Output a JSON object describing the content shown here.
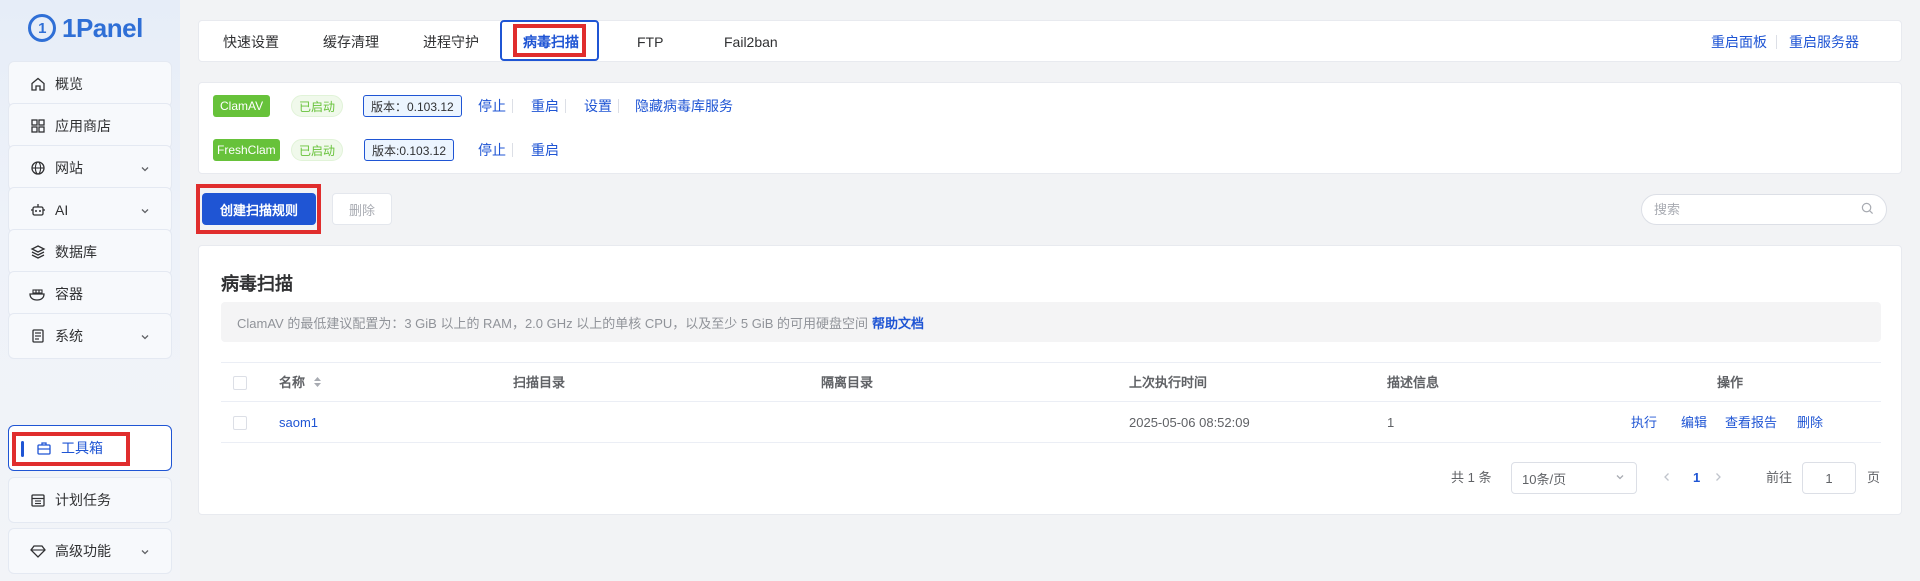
{
  "app": {
    "logo_text": "1Panel",
    "logo_mark": "1"
  },
  "sidebar": {
    "items": [
      {
        "label": "概览",
        "icon": "home-icon",
        "has_children": false
      },
      {
        "label": "应用商店",
        "icon": "grid-icon",
        "has_children": false
      },
      {
        "label": "网站",
        "icon": "globe-icon",
        "has_children": true
      },
      {
        "label": "AI",
        "icon": "robot-icon",
        "has_children": true
      },
      {
        "label": "数据库",
        "icon": "layers-icon",
        "has_children": false
      },
      {
        "label": "容器",
        "icon": "container-icon",
        "has_children": false
      },
      {
        "label": "系统",
        "icon": "system-icon",
        "has_children": true
      },
      {
        "label": "工具箱",
        "icon": "toolbox-icon",
        "has_children": false,
        "active": true
      },
      {
        "label": "计划任务",
        "icon": "calendar-icon",
        "has_children": false
      },
      {
        "label": "高级功能",
        "icon": "diamond-icon",
        "has_children": true
      }
    ]
  },
  "tabs": [
    {
      "label": "快速设置"
    },
    {
      "label": "缓存清理"
    },
    {
      "label": "进程守护"
    },
    {
      "label": "病毒扫描",
      "active": true
    },
    {
      "label": "FTP"
    },
    {
      "label": "Fail2ban"
    }
  ],
  "header_actions": {
    "restart_panel": "重启面板",
    "restart_server": "重启服务器"
  },
  "services": [
    {
      "name": "ClamAV",
      "status": "已启动",
      "version": "版本：0.103.12",
      "actions": [
        "停止",
        "重启",
        "设置",
        "隐藏病毒库服务"
      ]
    },
    {
      "name": "FreshClam",
      "status": "已启动",
      "version": "版本:0.103.12",
      "actions": [
        "停止",
        "重启"
      ]
    }
  ],
  "toolbar": {
    "create_label": "创建扫描规则",
    "delete_label": "删除",
    "search_placeholder": "搜索"
  },
  "section": {
    "title": "病毒扫描",
    "info_text": "ClamAV 的最低建议配置为：3 GiB 以上的 RAM，2.0 GHz 以上的单核 CPU，以及至少 5 GiB 的可用硬盘空间",
    "help_link": "帮助文档"
  },
  "table": {
    "columns": [
      "名称",
      "扫描目录",
      "隔离目录",
      "上次执行时间",
      "描述信息",
      "操作"
    ],
    "rows": [
      {
        "name": "saom1",
        "scan_dir": "",
        "quarantine_dir": "",
        "last_run": "2025-05-06 08:52:09",
        "description": "1",
        "actions": [
          "执行",
          "编辑",
          "查看报告",
          "删除"
        ]
      }
    ]
  },
  "pagination": {
    "total": "共 1 条",
    "page_size": "10条/页",
    "current_page": "1",
    "goto_label": "前往",
    "goto_value": "1",
    "page_suffix": "页"
  },
  "colors": {
    "accent": "#1f55d4",
    "success": "#67c23a",
    "highlight": "#e02d2d"
  }
}
